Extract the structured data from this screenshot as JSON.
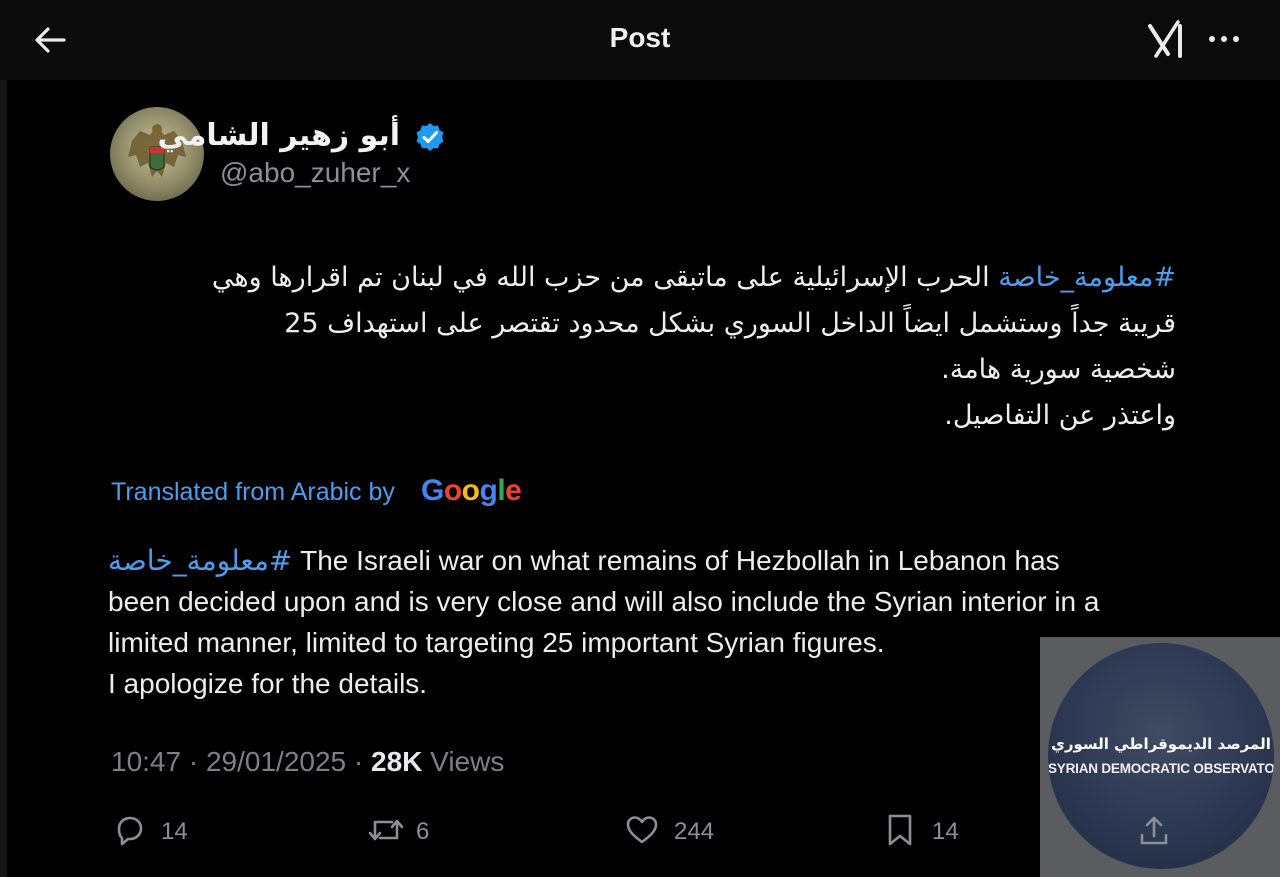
{
  "header": {
    "title": "Post",
    "back_icon": "arrow-left-icon",
    "grok_icon": "grok-icon",
    "more_icon": "more-horizontal-icon"
  },
  "author": {
    "display_name": "أبو زهير الشامي",
    "handle": "@abo_zuher_x",
    "verified": true,
    "verified_color": "#1d9bf0"
  },
  "tweet": {
    "arabic_lines": [
      {
        "hashtag": "#معلومة_خاصة",
        "text": " الحرب الإسرائيلية على ماتبقى من حزب الله في لبنان تم اقرارها وهي"
      },
      {
        "hashtag": "",
        "text": "قريبة جداً  وستشمل ايضاً الداخل السوري بشكل محدود تقتصر على استهداف 25"
      },
      {
        "hashtag": "",
        "text": "شخصية سورية هامة."
      },
      {
        "hashtag": "",
        "text": "واعتذر عن التفاصيل."
      }
    ],
    "translated_label": "Translated from Arabic by",
    "translator_brand": "Google",
    "english_hashtag": "#معلومة_خاصة",
    "english_lines": [
      " The Israeli war on what remains of Hezbollah in Lebanon has",
      "been decided upon and is very close and will also include the Syrian interior in a",
      "limited manner, limited to targeting 25 important Syrian figures.",
      "I apologize for the details."
    ]
  },
  "meta": {
    "time": "10:47",
    "date": "29/01/2025",
    "separator": "·",
    "views_count": "28K",
    "views_label": "Views"
  },
  "actions": {
    "replies": "14",
    "reposts": "6",
    "likes": "244",
    "bookmarks": "14"
  },
  "watermark": {
    "arabic": "المرصد الديموقراطي السوري",
    "english": "SYRIAN DEMOCRATIC OBSERVATORY"
  },
  "colors": {
    "accent": "#4a9ff0",
    "background": "#000000",
    "muted_text": "#7d8186"
  }
}
